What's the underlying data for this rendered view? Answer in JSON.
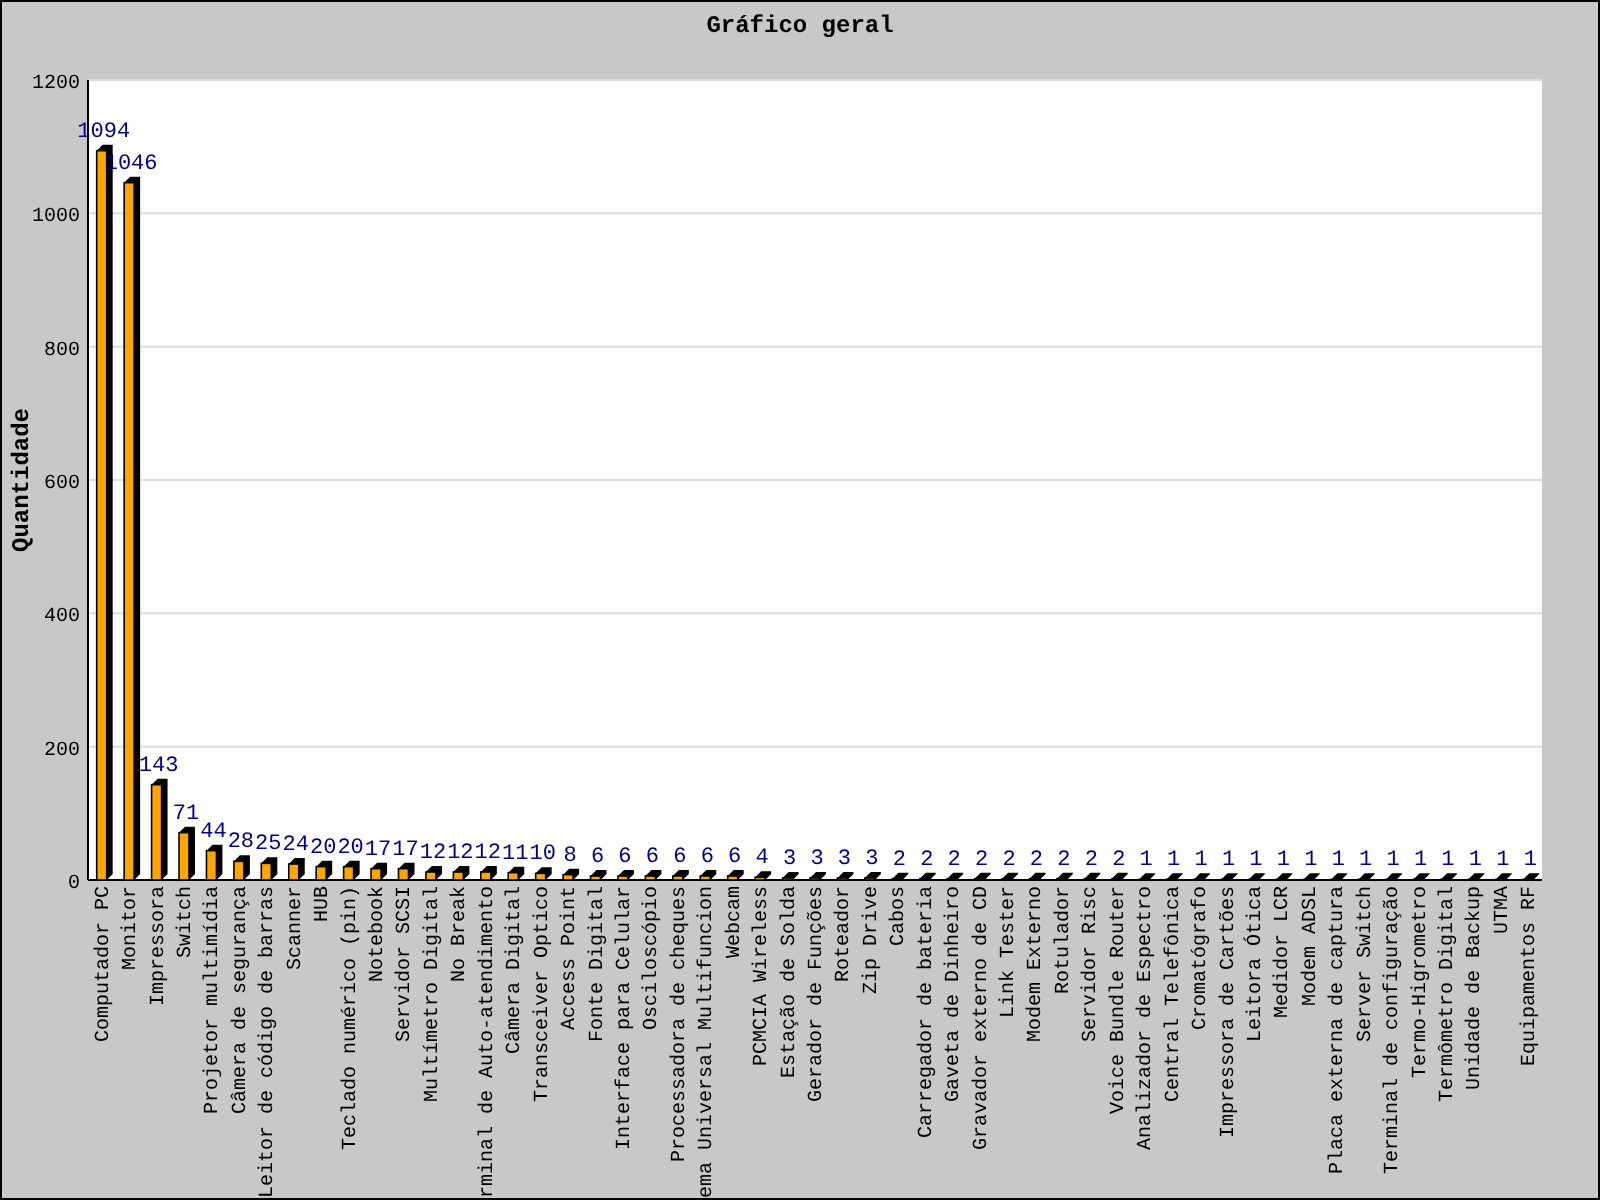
{
  "chart_data": {
    "type": "bar",
    "title": "Gráfico geral",
    "ylabel": "Quantidade",
    "ylim": [
      0,
      1200
    ],
    "yticks": [
      0,
      200,
      400,
      600,
      800,
      1000,
      1200
    ],
    "data_labels": true,
    "grid": true,
    "categories": [
      "Computador PC",
      "Monitor",
      "Impressora",
      "Switch",
      "Projetor multimídia",
      "Câmera de segurança",
      "Leitor de código de barras",
      "Scanner",
      "HUB",
      "Teclado numérico (pin)",
      "Notebook",
      "Servidor SCSI",
      "Multímetro Digital",
      "No Break",
      "rminal de Auto-atendimento",
      "Câmera Digital",
      "Transceiver Optico",
      "Access Point",
      "Fonte Digital",
      "Interface para Celular",
      "Osciloscópio",
      "Processadora de cheques",
      "ema Universal Multifuncion",
      "Webcam",
      "PCMCIA Wireless",
      "Estação de Solda",
      "Gerador de Funções",
      "Roteador",
      "Zip Drive",
      "Cabos",
      "Carregador de bateria",
      "Gaveta de Dinheiro",
      "Gravador externo de CD",
      "Link Tester",
      "Modem Externo",
      "Rotulador",
      "Servidor Risc",
      "Voice Bundle Router",
      "Analizador de Espectro",
      "Central Telefônica",
      "Cromatógrafo",
      "Impressora de Cartões",
      "Leitora Ótica",
      "Medidor LCR",
      "Modem ADSL",
      "Placa externa de captura",
      "Server Switch",
      "Terminal de configuração",
      "Termo-Higrometro",
      "Termômetro Digital",
      "Unidade de Backup",
      "UTMA",
      "Equipamentos RF"
    ],
    "values": [
      1094,
      1046,
      143,
      71,
      44,
      28,
      25,
      24,
      20,
      20,
      17,
      17,
      12,
      12,
      12,
      11,
      10,
      8,
      6,
      6,
      6,
      6,
      6,
      6,
      4,
      3,
      3,
      3,
      3,
      2,
      2,
      2,
      2,
      2,
      2,
      2,
      2,
      2,
      1,
      1,
      1,
      1,
      1,
      1,
      1,
      1,
      1,
      1,
      1,
      1,
      1,
      1,
      1
    ]
  }
}
